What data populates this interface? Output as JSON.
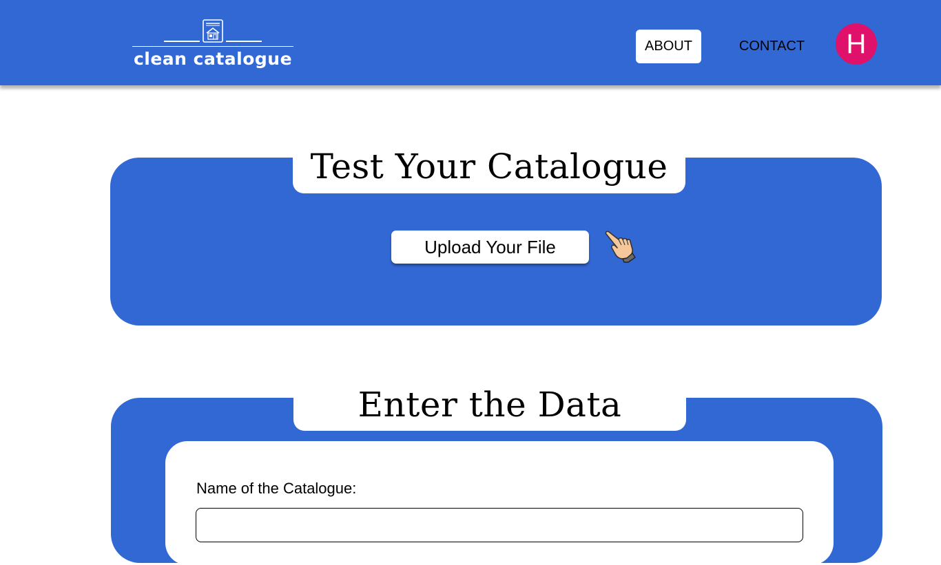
{
  "header": {
    "logo_text": "clean catalogue",
    "logo_icon": "catalogue-house-icon",
    "nav": {
      "about_label": "ABOUT",
      "contact_label": "CONTACT"
    },
    "avatar_initial": "H"
  },
  "test_section": {
    "title": "Test Your Catalogue",
    "upload_button_label": "Upload Your File",
    "pointer_icon": "pointing-hand-icon"
  },
  "data_section": {
    "title": "Enter the Data",
    "fields": {
      "catalogue_name_label": "Name of the Catalogue:",
      "catalogue_name_value": ""
    }
  },
  "colors": {
    "brand_blue": "#3168d4",
    "avatar_pink": "#e0116a",
    "white": "#ffffff",
    "text": "#000000"
  }
}
